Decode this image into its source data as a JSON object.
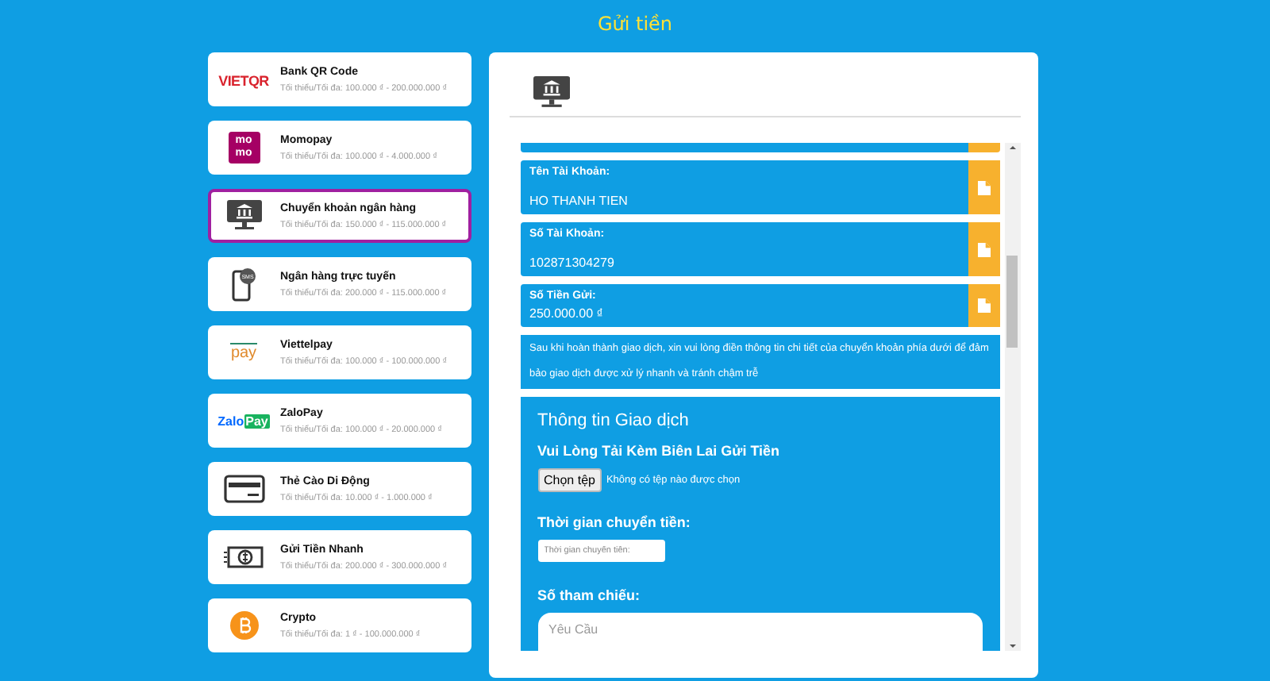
{
  "page_title": "Gửi tiền",
  "methods": [
    {
      "name": "Bank QR Code",
      "limits": "Tối thiểu/Tối đa: 100.000 ₫ - 200.000.000 ₫",
      "selected": false,
      "logo": {
        "kind": "vietqr",
        "text": "VIETQR"
      }
    },
    {
      "name": "Momopay",
      "limits": "Tối thiểu/Tối đa: 100.000 ₫ - 4.000.000 ₫",
      "selected": false,
      "logo": {
        "kind": "momo",
        "text": "mo",
        "text2": "mo"
      }
    },
    {
      "name": "Chuyển khoản ngân hàng",
      "limits": "Tối thiểu/Tối đa: 150.000 ₫ - 115.000.000 ₫",
      "selected": true,
      "logo": {
        "kind": "bank"
      }
    },
    {
      "name": "Ngân hàng trực tuyến",
      "limits": "Tối thiểu/Tối đa: 200.000 ₫ - 115.000.000 ₫",
      "selected": false,
      "logo": {
        "kind": "sms",
        "text": "SMS"
      }
    },
    {
      "name": "Viettelpay",
      "limits": "Tối thiểu/Tối đa: 100.000 ₫ - 100.000.000 ₫",
      "selected": false,
      "logo": {
        "kind": "viettel",
        "text": "pay"
      }
    },
    {
      "name": "ZaloPay",
      "limits": "Tối thiểu/Tối đa: 100.000 ₫ - 20.000.000 ₫",
      "selected": false,
      "logo": {
        "kind": "zalo",
        "text": "Zalo",
        "text2": "Pay"
      }
    },
    {
      "name": "Thẻ Cào Di Động",
      "limits": "Tối thiểu/Tối đa: 10.000 ₫ - 1.000.000 ₫",
      "selected": false,
      "logo": {
        "kind": "card"
      }
    },
    {
      "name": "Gửi Tiền Nhanh",
      "limits": "Tối thiểu/Tối đa: 200.000 ₫ - 300.000.000 ₫",
      "selected": false,
      "logo": {
        "kind": "cash"
      }
    },
    {
      "name": "Crypto",
      "limits": "Tối thiểu/Tối đa: 1 ₫ - 100.000.000 ₫",
      "selected": false,
      "logo": {
        "kind": "crypto"
      }
    }
  ],
  "details": [
    {
      "label": "Tên Tài Khoản:",
      "value": "HO THANH TIEN"
    },
    {
      "label": "Số Tài Khoản:",
      "value": "102871304279"
    },
    {
      "label": "Số Tiền Gửi:",
      "value": "250.000.00 ₫"
    }
  ],
  "notice": "Sau khi hoàn thành giao dịch, xin vui lòng điền thông tin chi tiết của chuyển khoản phía dưới để đảm bảo giao dịch được xử lý nhanh và tránh chậm trễ",
  "form": {
    "title": "Thông tin Giao dịch",
    "upload_label": "Vui Lòng Tải Kèm Biên Lai Gửi Tiền",
    "file_button": "Chọn tệp",
    "file_status": "Không có tệp nào được chọn",
    "time_label": "Thời gian chuyển tiền:",
    "time_placeholder": "Thời gian chuyển tiền:",
    "ref_label": "Số tham chiếu:",
    "ref_placeholder": "Yêu Cầu"
  }
}
